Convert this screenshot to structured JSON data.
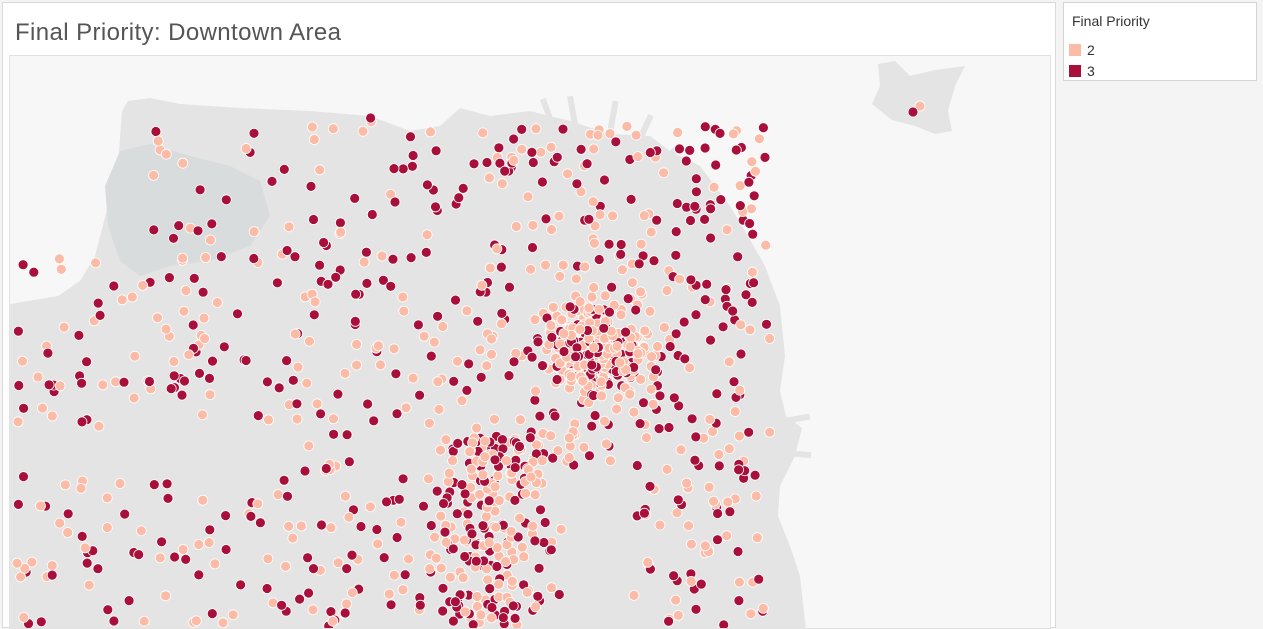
{
  "title": "Final Priority: Downtown Area",
  "legend": {
    "title": "Final Priority",
    "items": [
      {
        "label": "2",
        "color": "#fbbba6"
      },
      {
        "label": "3",
        "color": "#a8103b"
      }
    ]
  },
  "map": {
    "land_color": "#e4e4e4",
    "park_color": "#d9dcdc",
    "water_color": "#f7f7f7",
    "marker_stroke": "#ffffff"
  }
}
